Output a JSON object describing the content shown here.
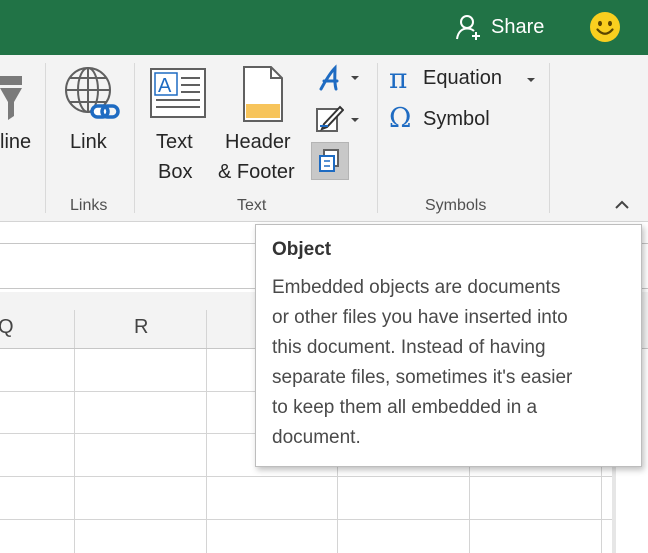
{
  "titlebar": {
    "share_label": "Share",
    "share_icon": "add-person-icon",
    "feedback_icon": "smiley-icon",
    "accent": "#217346"
  },
  "ribbon": {
    "partial_button_label": "line",
    "link_label": "Link",
    "textbox_label_1": "Text",
    "textbox_label_2": "Box",
    "header_label_1": "Header",
    "header_label_2": "& Footer",
    "equation_label": "Equation",
    "symbol_label": "Symbol",
    "groups": {
      "links": "Links",
      "text": "Text",
      "symbols": "Symbols"
    }
  },
  "sheet": {
    "columns": [
      "Q",
      "R"
    ]
  },
  "tooltip": {
    "title": "Object",
    "lines": [
      "Embedded objects are documents",
      "or other files you have inserted into",
      "this document. Instead of having",
      "separate files, sometimes it's easier",
      "to keep them all embedded in a",
      "document."
    ]
  }
}
